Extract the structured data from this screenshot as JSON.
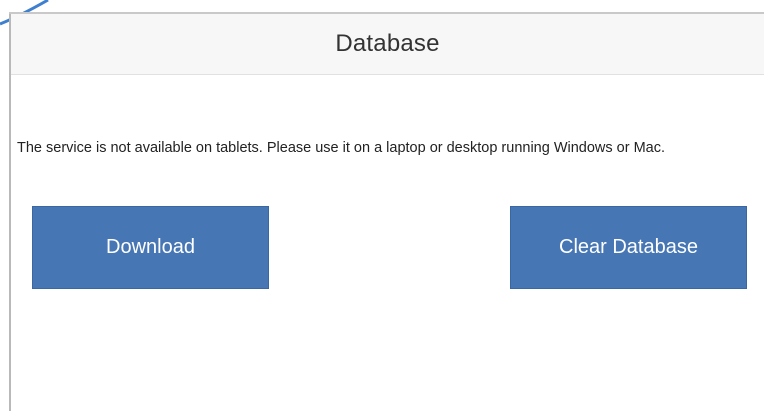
{
  "panel": {
    "title": "Database",
    "notice": "The service is not available on tablets. Please use it on a laptop or desktop running Windows or Mac."
  },
  "actions": {
    "download_label": "Download",
    "clear_label": "Clear Database"
  },
  "colors": {
    "button_bg": "#4676b3",
    "header_bg": "#f7f7f7",
    "corner_accent": "#3f7fd0"
  }
}
